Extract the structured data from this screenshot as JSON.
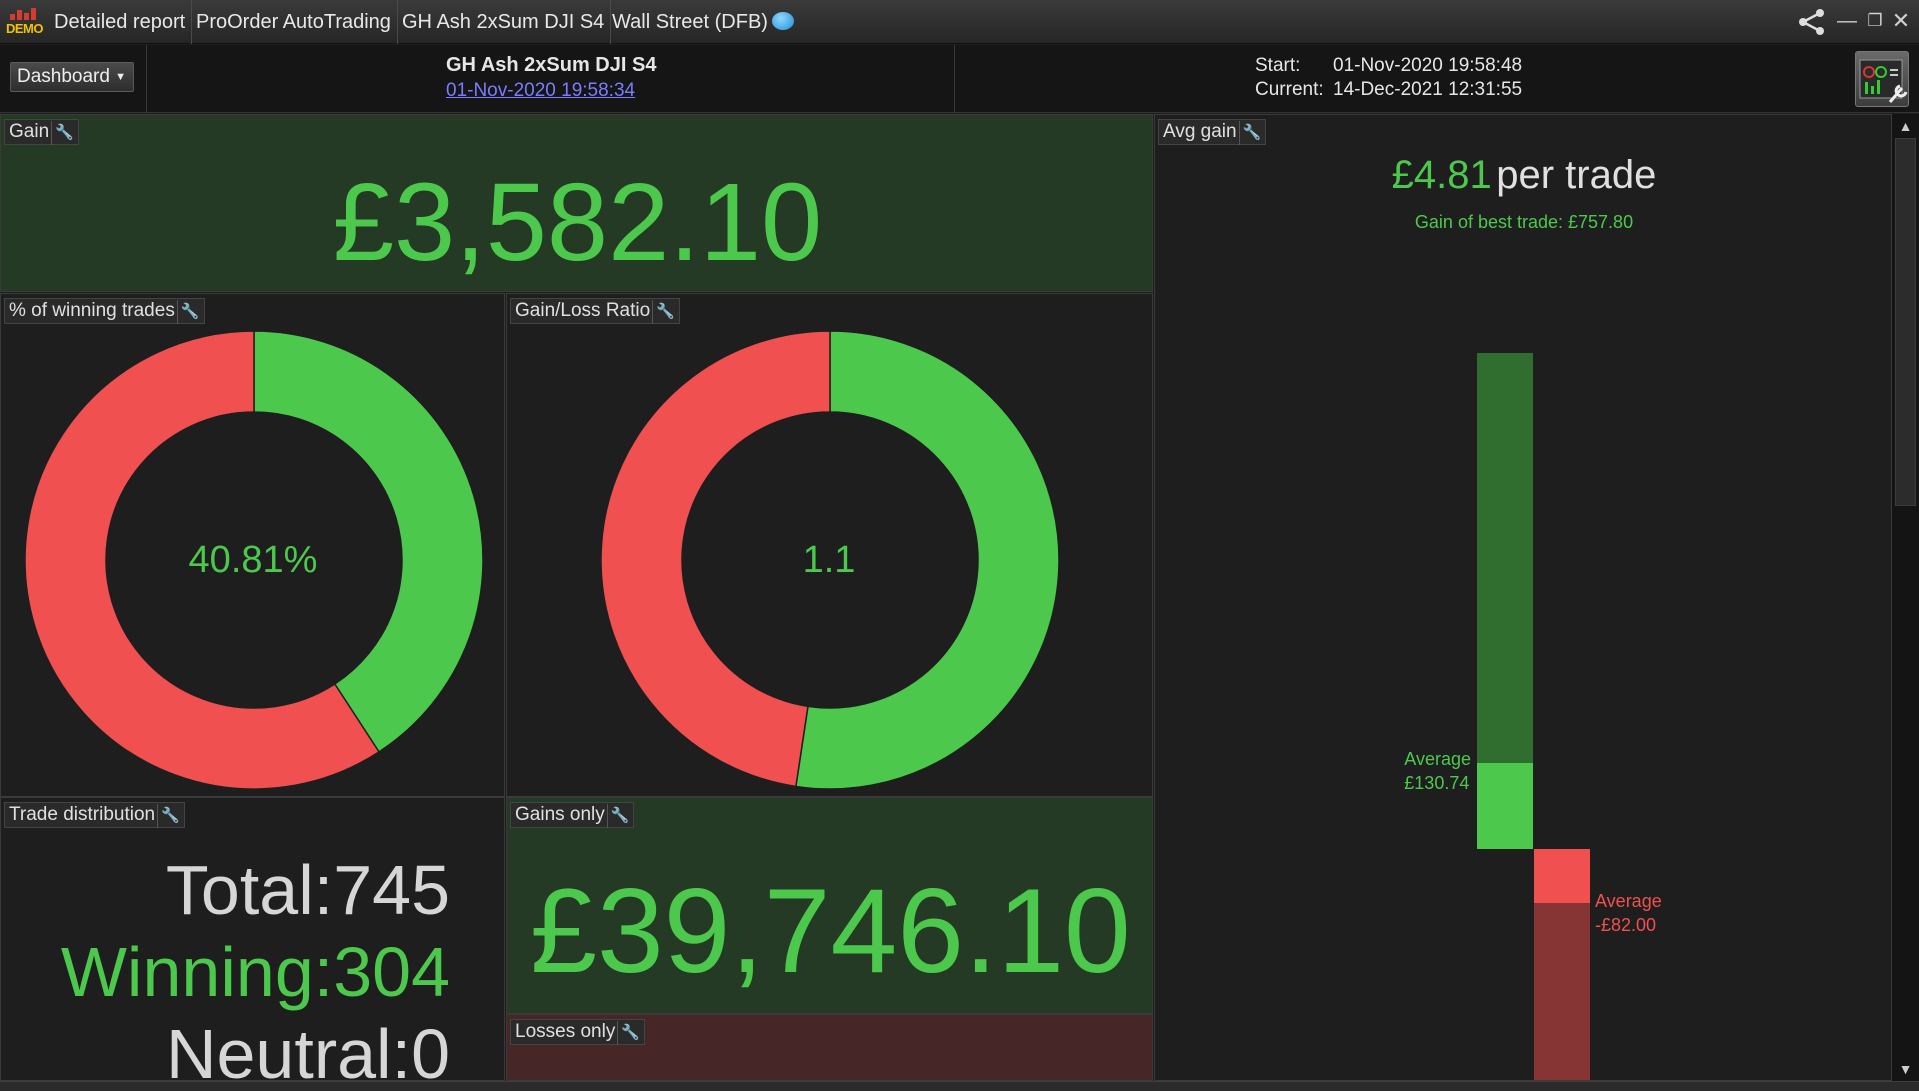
{
  "titlebar": {
    "demo_label": "DEMO",
    "breadcrumbs": [
      "Detailed report",
      "ProOrder AutoTrading",
      "GH Ash 2xSum DJI S4",
      "Wall Street (DFB)"
    ]
  },
  "header": {
    "dashboard_label": "Dashboard",
    "strategy_name": "GH Ash 2xSum DJI S4",
    "strategy_date": "01-Nov-2020 19:58:34",
    "start_label": "Start:",
    "start_value": "01-Nov-2020 19:58:48",
    "current_label": "Current:",
    "current_value": "14-Dec-2021 12:31:55"
  },
  "panels": {
    "gain": {
      "title": "Gain",
      "value": "£3,582.10"
    },
    "winning": {
      "title": "% of winning trades",
      "center": "40.81%",
      "green_fraction": 0.4081
    },
    "ratio": {
      "title": "Gain/Loss Ratio",
      "center": "1.1",
      "green_fraction": 0.5238
    },
    "distribution": {
      "title": "Trade distribution",
      "total_label": "Total:",
      "total_value": "745",
      "winning_label": "Winning:",
      "winning_value": "304",
      "neutral_label": "Neutral:",
      "neutral_value": "0"
    },
    "gains_only": {
      "title": "Gains only",
      "value": "£39,746.10"
    },
    "losses_only": {
      "title": "Losses only"
    },
    "avg_gain": {
      "title": "Avg gain",
      "value": "£4.81",
      "unit": "per trade",
      "best_trade": "Gain of best trade: £757.80",
      "avg_win_label": "Average",
      "avg_win_value": "£130.74",
      "avg_loss_label": "Average",
      "avg_loss_value": "-£82.00",
      "best": 757.8,
      "avg_win": 130.74,
      "avg_loss": 82.0
    }
  },
  "colors": {
    "green": "#4cc94c",
    "red": "#f05050",
    "dark_green_bg": "#243a24",
    "dark_red_bg": "#462626"
  }
}
